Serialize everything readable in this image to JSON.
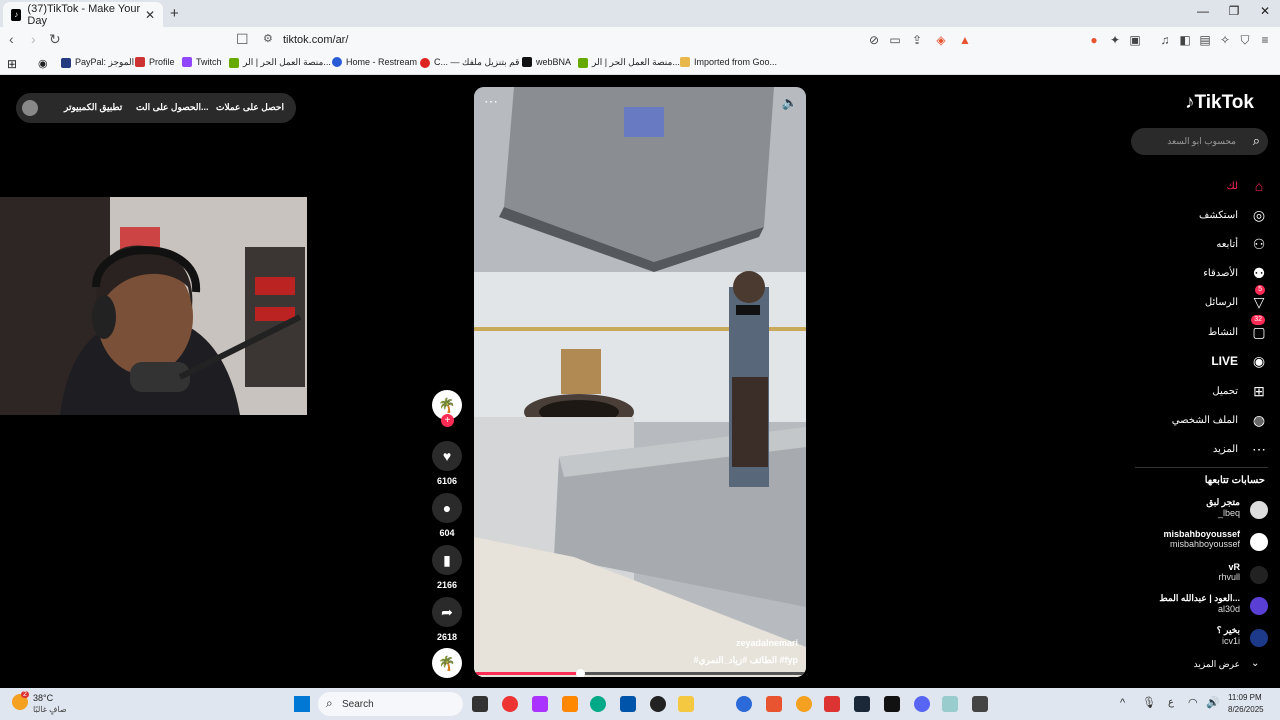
{
  "browser": {
    "tab_title": "(37)TikTok - Make Your Day",
    "url": "tiktok.com/ar/",
    "bookmarks": [
      "PayPal: الموجز",
      "Profile",
      "Twitch",
      "منصة العمل الحر | الر...",
      "Home - Restream",
      "C... — قم بتنزيل ملفك",
      "webBNA",
      "منصة العمل الحر | الر...",
      "Imported from Goo..."
    ]
  },
  "page": {
    "top_buttons": [
      "احصل على عملات",
      "الحصول على الت...",
      "تطبيق الكمبيوتر"
    ],
    "logo": "TikTok",
    "search_placeholder": "محسوب ابو السعد",
    "nav": [
      {
        "label": "لك",
        "icon": "home-icon",
        "active": true
      },
      {
        "label": "استكشف",
        "icon": "compass-icon"
      },
      {
        "label": "أتابعه",
        "icon": "follow-icon"
      },
      {
        "label": "الأصدقاء",
        "icon": "friends-icon"
      },
      {
        "label": "الرسائل",
        "icon": "send-icon",
        "badge": "5"
      },
      {
        "label": "النشاط",
        "icon": "message-icon",
        "badge": "32"
      },
      {
        "label": "LIVE",
        "icon": "live-icon"
      },
      {
        "label": "تحميل",
        "icon": "upload-icon"
      },
      {
        "label": "الملف الشخصي",
        "icon": "profile-icon"
      },
      {
        "label": "المزيد",
        "icon": "more-icon"
      }
    ],
    "following_title": "حسابات تتابعها",
    "following": [
      {
        "name": "متجر لبق",
        "handle": "_lbeq"
      },
      {
        "name": "misbahboyoussef",
        "handle": "misbahboyoussef"
      },
      {
        "name": "vR",
        "handle": "rhvull"
      },
      {
        "name": "العود | عبدالله المط...",
        "handle": "al30d"
      },
      {
        "name": "بخير ؟",
        "handle": "icv1i"
      }
    ],
    "show_more": "عرض المزيد",
    "video": {
      "username": "zeyadalnemari",
      "caption": "#الطائف #زياد_النمري #fyp",
      "progress": 0.32
    },
    "counts": {
      "likes": "6106",
      "comments": "604",
      "saves": "2166",
      "shares": "2618"
    }
  },
  "taskbar": {
    "weather_temp": "38°C",
    "weather_desc": "صافٍ غالبًا",
    "search": "Search",
    "time": "11:09 PM",
    "date": "8/26/2025",
    "weather_badge": "2",
    "lang": "ع"
  },
  "colors": {
    "accent": "#fe2c55",
    "bg": "#000000"
  }
}
